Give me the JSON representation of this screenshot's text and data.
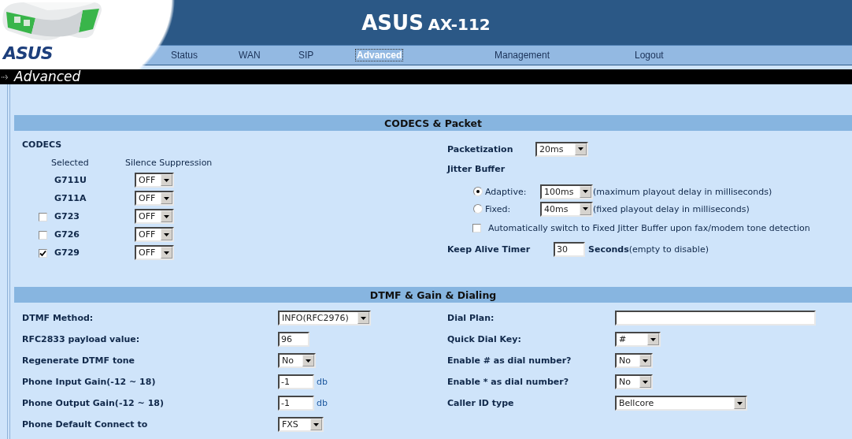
{
  "header": {
    "logo": "ASUS",
    "brand": "ASUS",
    "model": "AX-112"
  },
  "nav": [
    {
      "label": "Status",
      "selected": false
    },
    {
      "label": "WAN",
      "selected": false
    },
    {
      "label": "SIP",
      "selected": false
    },
    {
      "label": "Advanced",
      "selected": true
    },
    {
      "label": "Management",
      "selected": false
    },
    {
      "label": "Logout",
      "selected": false
    }
  ],
  "page_title": "Advanced",
  "codecs_packet": {
    "title": "CODECS & Packet",
    "codecs": {
      "heading": "CODECS",
      "column_headers": [
        "Selected",
        "Silence Suppression"
      ],
      "rows": [
        {
          "name": "G711U",
          "kind": "fixed",
          "suppression": "OFF"
        },
        {
          "name": "G711A",
          "kind": "fixed",
          "suppression": "OFF"
        },
        {
          "name": "G723",
          "kind": "optional",
          "checked": false,
          "suppression": "OFF"
        },
        {
          "name": "G726",
          "kind": "optional",
          "checked": false,
          "suppression": "OFF"
        },
        {
          "name": "G729",
          "kind": "optional",
          "checked": true,
          "suppression": "OFF"
        }
      ]
    },
    "packetization": {
      "label": "Packetization",
      "value": "20ms"
    },
    "jitter_buffer": {
      "heading": "Jitter Buffer",
      "modes": [
        {
          "label": "Adaptive:",
          "selected": true,
          "value": "100ms",
          "note": "(maximum playout delay in milliseconds)"
        },
        {
          "label": "Fixed:",
          "selected": false,
          "value": "40ms",
          "note": "(fixed playout delay in milliseconds)"
        }
      ],
      "auto_switch": {
        "label": "Automatically switch to Fixed Jitter Buffer upon fax/modem tone detection",
        "checked": false
      }
    },
    "keep_alive": {
      "label": "Keep Alive Timer",
      "value": "30",
      "unit": "Seconds",
      "note": "(empty to disable)"
    }
  },
  "dtmf_gain_dialing": {
    "title": "DTMF & Gain & Dialing",
    "left": [
      {
        "label": "DTMF Method:",
        "kind": "select",
        "value": "INFO(RFC2976)"
      },
      {
        "label": "RFC2833 payload value:",
        "kind": "input",
        "value": "96"
      },
      {
        "label": "Regenerate DTMF tone",
        "kind": "select",
        "value": "No"
      },
      {
        "label": "Phone Input Gain(-12 ~ 18)",
        "kind": "input",
        "value": "-1",
        "unit": "db"
      },
      {
        "label": "Phone Output Gain(-12 ~ 18)",
        "kind": "input",
        "value": "-1",
        "unit": "db"
      },
      {
        "label": "Phone Default Connect to",
        "kind": "select",
        "value": "FXS"
      }
    ],
    "right": [
      {
        "label": "Dial Plan:",
        "kind": "input"
      },
      {
        "label": "Quick Dial Key:",
        "kind": "select",
        "value": "#"
      },
      {
        "label": "Enable # as dial number?",
        "kind": "select",
        "value": "No"
      },
      {
        "label": "Enable * as dial number?",
        "kind": "select",
        "value": "No"
      },
      {
        "label": "Caller ID type",
        "kind": "select",
        "value": "Bellcore"
      }
    ]
  }
}
